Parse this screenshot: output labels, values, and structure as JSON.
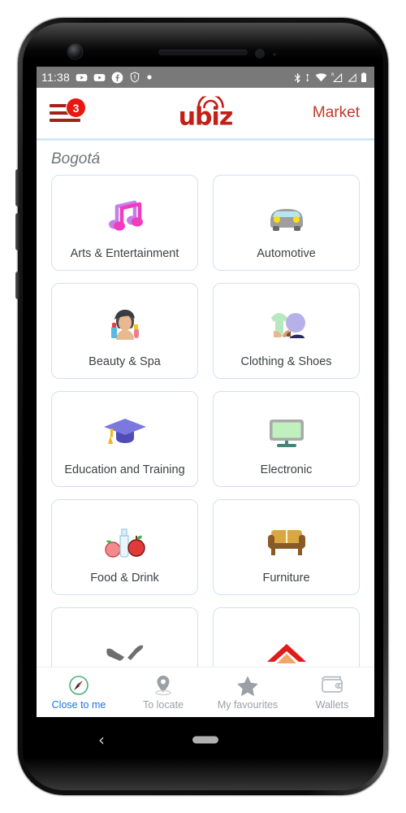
{
  "status_bar": {
    "time": "11:38",
    "left_icons": [
      "youtube-icon",
      "youtube-icon",
      "facebook-icon",
      "shield-alert-icon",
      "dot-icon"
    ],
    "right_icons": [
      "bluetooth-icon",
      "data-transfer-icon",
      "wifi-icon",
      "roaming-signal-icon",
      "cellular-signal-icon",
      "battery-icon"
    ]
  },
  "header": {
    "menu_badge_count": "3",
    "brand": "ubiz",
    "market_label": "Market",
    "brand_color": "#c31f15",
    "menu_color": "#a3211c",
    "badge_color": "#e8170f"
  },
  "content": {
    "city": "Bogotá",
    "categories": [
      {
        "label": "Arts & Entertainment",
        "icon": "music-notes-icon"
      },
      {
        "label": "Automotive",
        "icon": "car-icon"
      },
      {
        "label": "Beauty & Spa",
        "icon": "beauty-woman-icon"
      },
      {
        "label": "Clothing & Shoes",
        "icon": "clothing-shoes-icon"
      },
      {
        "label": "Education and Training",
        "icon": "graduation-cap-icon"
      },
      {
        "label": "Electronic",
        "icon": "monitor-icon"
      },
      {
        "label": "Food & Drink",
        "icon": "food-drink-icon"
      },
      {
        "label": "Furniture",
        "icon": "couch-icon"
      },
      {
        "label": "",
        "icon": "tools-wrench-icon"
      },
      {
        "label": "",
        "icon": "house-roof-icon"
      }
    ]
  },
  "tab_bar": {
    "active_index": 0,
    "active_color": "#1a73e8",
    "inactive_color": "#9aa0a6",
    "items": [
      {
        "label": "Close to me",
        "icon": "compass-icon"
      },
      {
        "label": "To locate",
        "icon": "map-pin-icon"
      },
      {
        "label": "My favourites",
        "icon": "star-icon"
      },
      {
        "label": "Wallets",
        "icon": "wallet-icon"
      }
    ]
  },
  "android_nav": {
    "back_glyph": "‹",
    "home_pill": "home-gesture-pill"
  }
}
